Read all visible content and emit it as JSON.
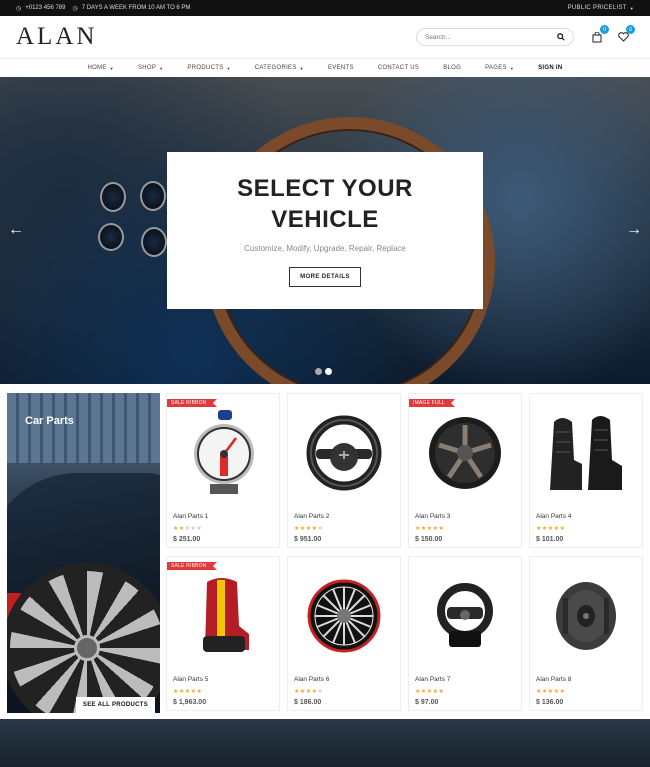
{
  "topbar": {
    "phone": "+0123 456 789",
    "hours": "7 DAYS A WEEK FROM 10 AM TO 6 PM",
    "pricelist": "PUBLIC PRICELIST"
  },
  "header": {
    "logo": "ALAN",
    "search_placeholder": "Search...",
    "cart_count": "0",
    "wishlist_count": "0"
  },
  "nav": {
    "items": [
      {
        "label": "HOME",
        "dropdown": true
      },
      {
        "label": "SHOP",
        "dropdown": true
      },
      {
        "label": "PRODUCTS",
        "dropdown": true
      },
      {
        "label": "CATEGORIES",
        "dropdown": true
      },
      {
        "label": "EVENTS",
        "dropdown": false
      },
      {
        "label": "CONTACT US",
        "dropdown": false
      },
      {
        "label": "BLOG",
        "dropdown": false
      },
      {
        "label": "PAGES",
        "dropdown": true
      },
      {
        "label": "SIGN IN",
        "dropdown": false
      }
    ]
  },
  "hero": {
    "title_line1": "SELECT YOUR",
    "title_line2": "VEHICLE",
    "subtitle": "Customize, Modify, Upgrade, Repair, Replace",
    "button": "MORE DETAILS",
    "active_slide": 2,
    "slide_count": 2
  },
  "promo": {
    "title": "Car Parts",
    "button": "SEE ALL PRODUCTS"
  },
  "products": [
    {
      "name": "Alan Parts 1",
      "price": "$ 251.00",
      "rating": 2,
      "ribbon": "SALE RIBBON",
      "icon": "tachometer-icon"
    },
    {
      "name": "Alan Parts 2",
      "price": "$ 951.00",
      "rating": 4,
      "ribbon": "",
      "icon": "steering-wheel-icon"
    },
    {
      "name": "Alan Parts 3",
      "price": "$ 150.00",
      "rating": 5,
      "ribbon": "IMAGE FULL",
      "icon": "alloy-rim-icon"
    },
    {
      "name": "Alan Parts 4",
      "price": "$ 101.00",
      "rating": 5,
      "ribbon": "",
      "icon": "racing-seats-icon"
    },
    {
      "name": "Alan Parts 5",
      "price": "$ 1,963.00",
      "rating": 5,
      "ribbon": "SALE RIBBON",
      "icon": "racing-seat-icon"
    },
    {
      "name": "Alan Parts 6",
      "price": "$ 186.00",
      "rating": 4,
      "ribbon": "",
      "icon": "sport-rim-icon"
    },
    {
      "name": "Alan Parts 7",
      "price": "$ 97.00",
      "rating": 5,
      "ribbon": "",
      "icon": "gaming-wheel-icon"
    },
    {
      "name": "Alan Parts 8",
      "price": "$ 136.00",
      "rating": 5,
      "ribbon": "",
      "icon": "brake-disc-icon"
    }
  ],
  "colors": {
    "accent": "#1e9be0",
    "ribbon": "#e23a3a",
    "star": "#f5a623",
    "topbar": "#111111"
  }
}
